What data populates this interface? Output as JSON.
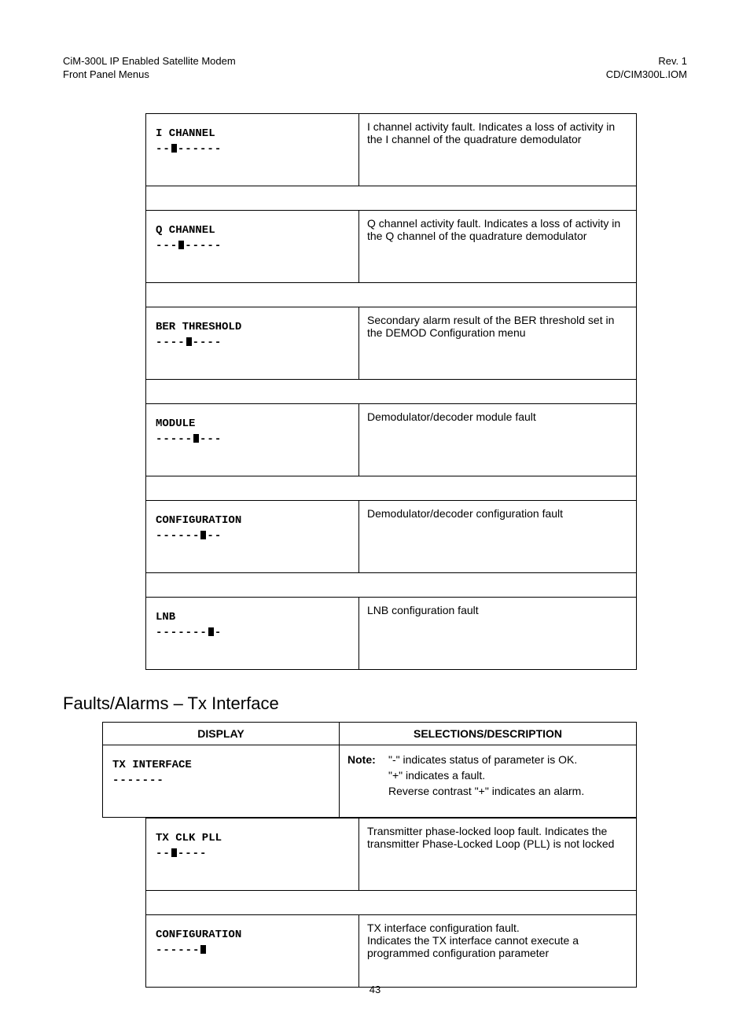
{
  "header": {
    "left_line1": "CiM-300L IP Enabled Satellite Modem",
    "left_line2": "Front Panel Menus",
    "right_line1": "Rev. 1",
    "right_line2": "CD/CIM300L.IOM"
  },
  "upper_rows": [
    {
      "label": "I CHANNEL",
      "pattern": "--B------",
      "desc": "I channel activity fault. Indicates a loss of activity in the I channel of the quadrature demodulator"
    },
    {
      "label": "Q CHANNEL",
      "pattern": "---B-----",
      "desc": "Q channel activity fault. Indicates a loss of activity in the Q channel of the quadrature demodulator"
    },
    {
      "label": "BER THRESHOLD",
      "pattern": "----B----",
      "desc": "Secondary alarm result of the BER threshold set in the DEMOD Configuration menu"
    },
    {
      "label": "MODULE",
      "pattern": "-----B---",
      "desc": "Demodulator/decoder module fault"
    },
    {
      "label": "CONFIGURATION",
      "pattern": "------B--",
      "desc": "Demodulator/decoder configuration fault"
    },
    {
      "label": "LNB",
      "pattern": "-------B-",
      "desc": "LNB configuration fault"
    }
  ],
  "section_title": "Faults/Alarms – Tx Interface",
  "tx_table": {
    "col1": "DISPLAY",
    "col2": "SELECTIONS/DESCRIPTION",
    "intro_label": "TX INTERFACE",
    "intro_pattern": "-------",
    "note_bold": "Note:",
    "note_line1": "\"-\" indicates status of parameter is OK.",
    "note_line2": "\"+\" indicates a fault.",
    "note_line3": "Reverse contrast \"+\" indicates an alarm.",
    "rows": [
      {
        "label": "TX CLK PLL",
        "pattern": "--B----",
        "desc": "Transmitter phase-locked loop fault. Indicates the transmitter Phase-Locked Loop (PLL) is not locked"
      },
      {
        "label": "CONFIGURATION",
        "pattern": "------B",
        "desc": "TX interface configuration fault.\nIndicates the TX interface cannot execute a programmed configuration parameter"
      }
    ]
  },
  "page_number": "43"
}
